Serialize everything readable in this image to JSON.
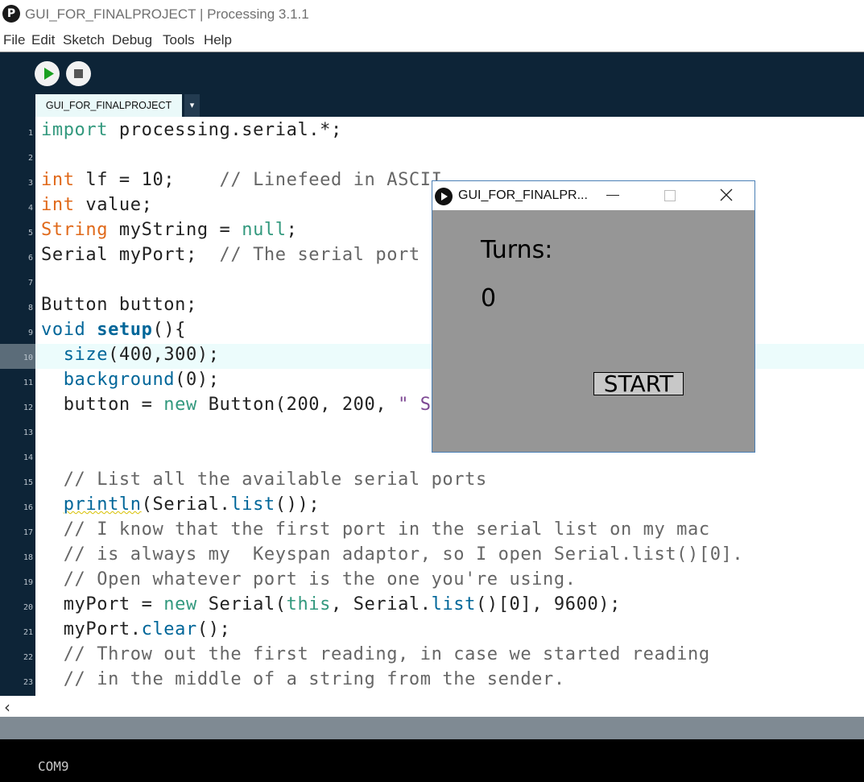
{
  "window": {
    "title": "GUI_FOR_FINALPROJECT | Processing 3.1.1",
    "icon": "processing-logo-icon"
  },
  "menu": [
    "File",
    "Edit",
    "Sketch",
    "Debug",
    "Tools",
    "Help"
  ],
  "toolbar": {
    "run_icon": "play-icon",
    "stop_icon": "stop-icon"
  },
  "tabs": [
    {
      "label": "GUI_FOR_FINALPROJECT"
    }
  ],
  "tab_menu_icon": "▾",
  "code": {
    "line_numbers": [
      "1",
      "2",
      "3",
      "4",
      "5",
      "6",
      "7",
      "8",
      "9",
      "10",
      "11",
      "12",
      "13",
      "14",
      "15",
      "16",
      "17",
      "18",
      "19",
      "20",
      "21",
      "22",
      "23"
    ],
    "l1a": "import",
    "l1b": " processing.serial.*;",
    "l3a": "int",
    "l3b": " lf = 10;    ",
    "l3c": "// Linefeed in ASCII",
    "l4a": "int",
    "l4b": " value;",
    "l5a": "String",
    "l5b": " myString = ",
    "l5c": "null",
    "l5d": ";",
    "l6a": "Serial myPort;  ",
    "l6b": "// The serial port",
    "l8": "Button button;",
    "l9a": "void",
    "l9b": " ",
    "l9c": "setup",
    "l9d": "(){",
    "l10a": "  ",
    "l10b": "size",
    "l10c": "(400,300);",
    "l11a": "  ",
    "l11b": "background",
    "l11c": "(0);",
    "l12a": "  button = ",
    "l12b": "new",
    "l12c": " Button(200, 200, ",
    "l12d": "\" S",
    "l15": "  // List all the available serial ports",
    "l16a": "  ",
    "l16b": "println",
    "l16c": "(Serial.",
    "l16d": "list",
    "l16e": "());",
    "l17": "  // I know that the first port in the serial list on my mac",
    "l18": "  // is always my  Keyspan adaptor, so I open Serial.list()[0].",
    "l19": "  // Open whatever port is the one you're using.",
    "l20a": "  myPort = ",
    "l20b": "new",
    "l20c": " Serial(",
    "l20d": "this",
    "l20e": ", Serial.",
    "l20f": "list",
    "l20g": "()[0], 9600);",
    "l21a": "  myPort.",
    "l21b": "clear",
    "l21c": "();",
    "l22": "  // Throw out the first reading, in case we started reading",
    "l23": "  // in the middle of a string from the sender."
  },
  "scroll_left_icon": "‹",
  "console": {
    "port": "COM9"
  },
  "sketch_window": {
    "title": "GUI_FOR_FINALPR...",
    "turns_label": "Turns:",
    "turns_value": "0",
    "start_label": "START"
  },
  "colors": {
    "toolbar_bg": "#0d2437",
    "sketch_bg": "#969696",
    "keyword": "#e0691a",
    "function": "#006699",
    "literal": "#33997e"
  }
}
